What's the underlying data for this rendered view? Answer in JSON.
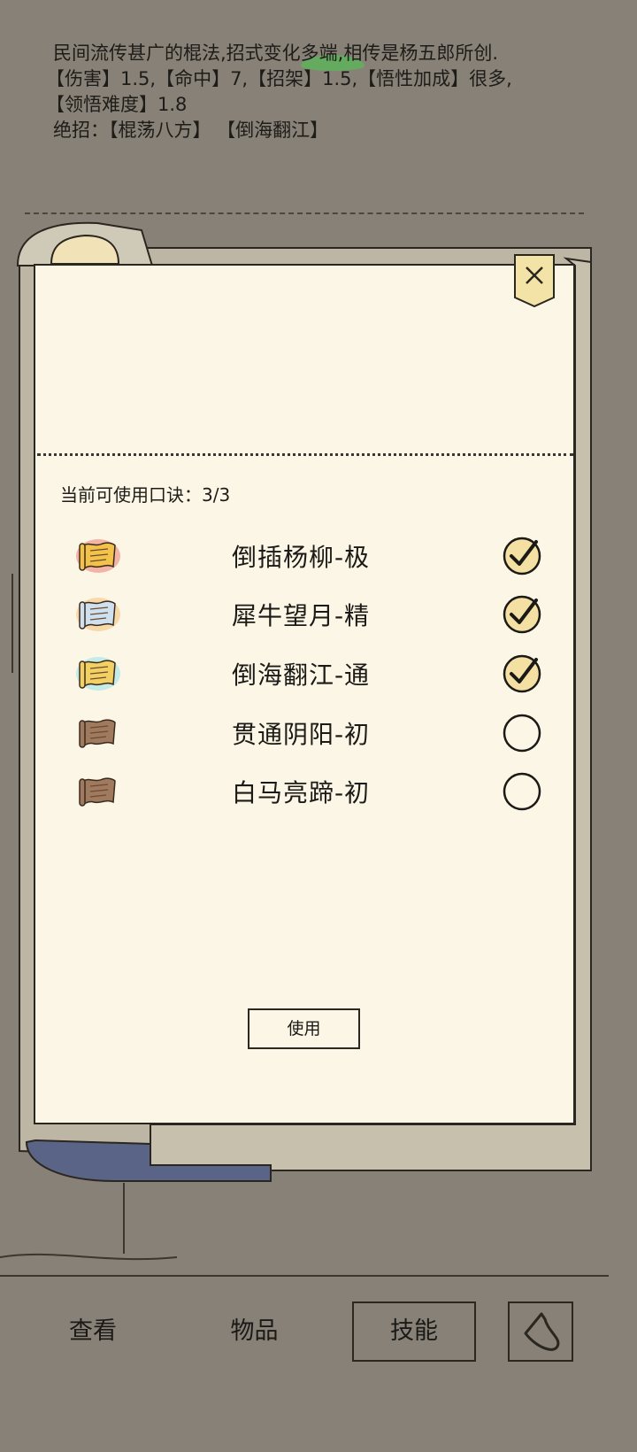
{
  "description": {
    "line1": "民间流传甚广的棍法,招式变化多端,相传是杨五郎所创.",
    "line2": "【伤害】1.5,【命中】7,【招架】1.5,【悟性加成】很多,",
    "line3": "【领悟难度】1.8",
    "line4": "绝招：【棍荡八方】  【倒海翻江】"
  },
  "panel": {
    "quota_label": "当前可使用口诀：3/3",
    "use_button": "使用"
  },
  "mantras": [
    {
      "name": "倒插杨柳-极",
      "selected": true,
      "icon": "gold-scroll-icon",
      "glow": "#e83a2a",
      "paper": "#f2c24a"
    },
    {
      "name": "犀牛望月-精",
      "selected": true,
      "icon": "blue-scroll-icon",
      "glow": "#f3a63a",
      "paper": "#cfe0ee"
    },
    {
      "name": "倒海翻江-通",
      "selected": true,
      "icon": "gold-scroll-icon",
      "glow": "#5fd6e6",
      "paper": "#f2d063"
    },
    {
      "name": "贯通阴阳-初",
      "selected": false,
      "icon": "brown-scroll-icon",
      "glow": "none",
      "paper": "#a07a5e"
    },
    {
      "name": "白马亮蹄-初",
      "selected": false,
      "icon": "brown-scroll-icon",
      "glow": "none",
      "paper": "#a07a5e"
    }
  ],
  "nav": {
    "view": "查看",
    "items": "物品",
    "skills": "技能"
  },
  "colors": {
    "background": "#878177",
    "paper": "#fbf6e6",
    "scroll_outer": "#bdb6a4",
    "scroll_roll": "#5a6486",
    "close_tag": "#f3e3a6"
  }
}
